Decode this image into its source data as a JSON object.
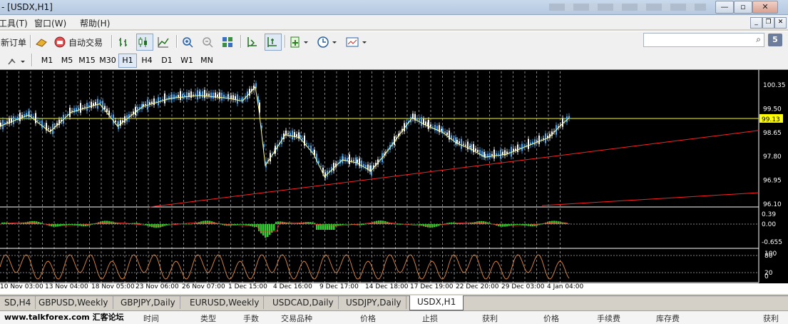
{
  "window": {
    "title": "- [USDX,H1]"
  },
  "menu": {
    "tools": "工具(T)",
    "window": "窗口(W)",
    "help": "帮助(H)"
  },
  "toolbar": {
    "new_order": "新订单",
    "auto_trade": "自动交易"
  },
  "timeframes": [
    "M1",
    "M5",
    "M15",
    "M30",
    "H1",
    "H4",
    "D1",
    "W1",
    "MN"
  ],
  "active_timeframe": "H1",
  "badge": "5",
  "chart": {
    "price_labels": [
      "100.35",
      "99.50",
      "99.13",
      "98.65",
      "97.80",
      "96.95",
      "96.10"
    ],
    "current_price": "99.13",
    "osc1_labels": [
      "0.39",
      "0.00",
      "-0.655"
    ],
    "osc2_labels": [
      "100",
      "80",
      "20",
      "0"
    ],
    "time_labels": [
      "10 Nov 03:00",
      "13 Nov 04:00",
      "18 Nov 05:00",
      "23 Nov 06:00",
      "26 Nov 07:00",
      "1 Dec 15:00",
      "4 Dec 16:00",
      "9 Dec 17:00",
      "14 Dec 18:00",
      "17 Dec 19:00",
      "22 Dec 20:00",
      "29 Dec 03:00",
      "4 Jan 04:00"
    ],
    "colors": {
      "bull": "#3fa9f5",
      "bear": "#ffffff",
      "ma": "#ffff99",
      "price_line": "#ffff00",
      "trend": "#ff2020",
      "hist": "#33cc33",
      "stoch": "#d08040"
    }
  },
  "tabs": [
    "SD,H4",
    "GBPUSD,Weekly",
    "GBPJPY,Daily",
    "EURUSD,Weekly",
    "USDCAD,Daily",
    "USDJPY,Daily",
    "USDX,H1"
  ],
  "active_tab": "USDX,H1",
  "terminal": {
    "watermark": "www.talkforex.com 汇客论坛",
    "columns": [
      "时间",
      "类型",
      "手数",
      "交易品种",
      "价格",
      "止损",
      "获利",
      "价格",
      "手续费",
      "库存费",
      "获利"
    ]
  }
}
